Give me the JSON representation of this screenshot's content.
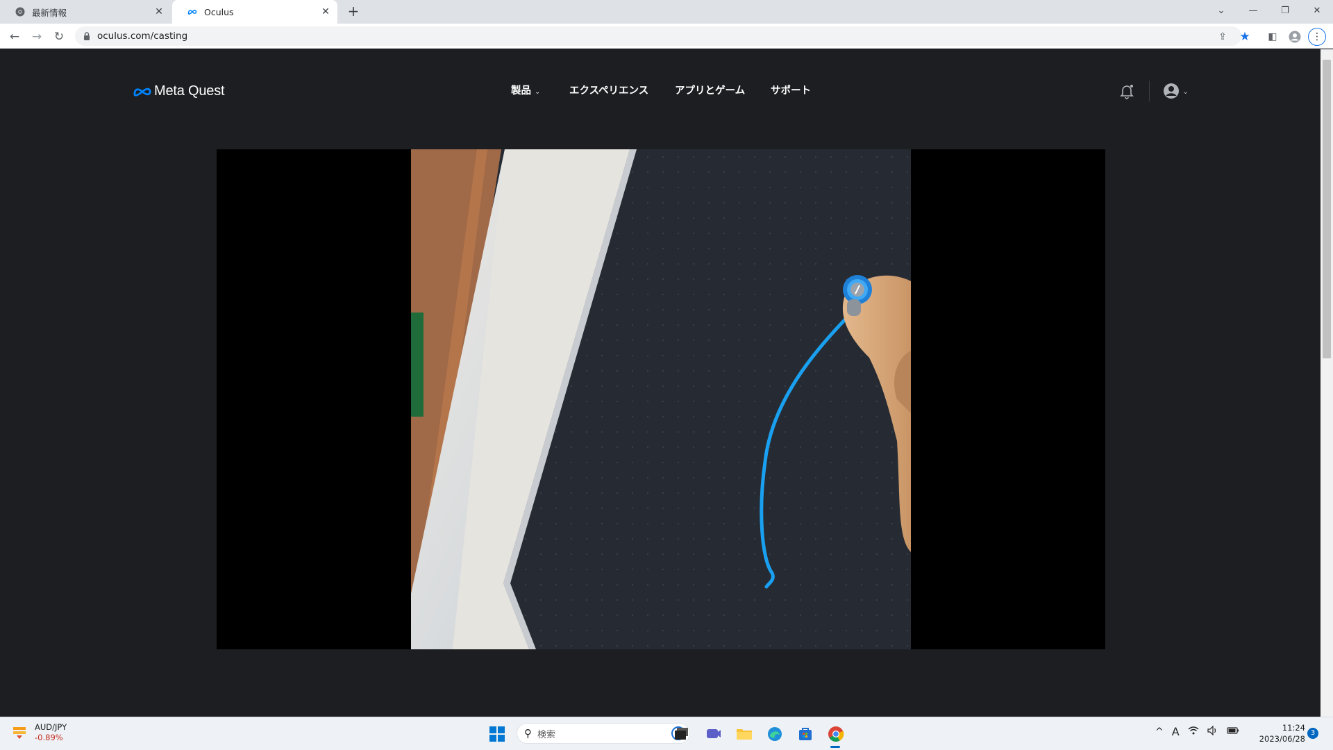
{
  "browser": {
    "tabs": [
      {
        "title": "最新情報",
        "icon": "chrome-icon",
        "active": false
      },
      {
        "title": "Oculus",
        "icon": "meta-icon",
        "active": true
      }
    ],
    "url": "oculus.com/casting"
  },
  "site": {
    "logo_text": "Meta Quest",
    "nav": [
      {
        "label": "製品",
        "has_dropdown": true
      },
      {
        "label": "エクスペリエンス"
      },
      {
        "label": "アプリとゲーム"
      },
      {
        "label": "サポート"
      }
    ]
  },
  "cast_view": {
    "scene": "VR headset stream: white panel edge at left, hand holding controller drawing a blue stroke on dark dotted surface"
  },
  "taskbar": {
    "ticker": {
      "pair": "AUD/JPY",
      "change": "-0.89%"
    },
    "search_placeholder": "検索",
    "time": "11:24",
    "date": "2023/06/28",
    "notifications": "3",
    "ime": "A"
  },
  "colors": {
    "page_bg": "#1c1e21",
    "meta_blue": "#0082fb",
    "stroke_blue": "#1aa0f0"
  }
}
